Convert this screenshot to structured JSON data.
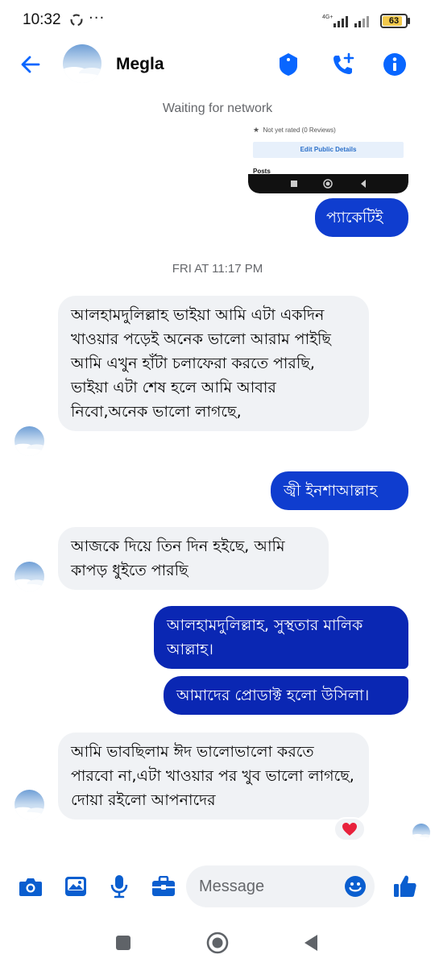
{
  "status_bar": {
    "time": "10:32",
    "dots": "···",
    "battery": "63"
  },
  "header": {
    "contact_name": "Megla"
  },
  "chat": {
    "network_status": "Waiting for network",
    "shared_screenshot": {
      "rating_text": "Not yet rated (0 Reviews)",
      "button_text": "Edit Public Details",
      "posts_text": "Posts"
    },
    "timestamp": "FRI AT 11:17 PM",
    "messages": [
      {
        "from": "me",
        "text": "প্যাকেটিই"
      },
      {
        "from": "them",
        "text": "আলহামদুলিল্লাহ ভাইয়া আমি এটা একদিন খাওয়ার পড়েই অনেক ভালো আরাম পাইছি আমি এখুন হাঁটা চলাফেরা করতে পারছি, ভাইয়া এটা শেষ হলে আমি আবার নিবো,অনেক  ভালো লাগছে,"
      },
      {
        "from": "me",
        "text": "জ্বী ইনশাআল্লাহ"
      },
      {
        "from": "them",
        "text": "আজকে দিয়ে তিন দিন হইছে, আমি কাপড় ধুইতে পারছি"
      },
      {
        "from": "me",
        "text": "আলহামদুলিল্লাহ, সুস্থতার মালিক আল্লাহ।"
      },
      {
        "from": "me",
        "text": "আমাদের প্রোডাক্ট হলো উসিলা।"
      },
      {
        "from": "them",
        "text": "আমি ভাবছিলাম ঈদ ভালোভালো করতে পারবো না,এটা খাওয়ার পর খুব ভালো লাগছে, দোয়া রইলো আপনাদের"
      }
    ],
    "reaction": "heart"
  },
  "composer": {
    "placeholder": "Message"
  },
  "colors": {
    "accent": "#0866ff",
    "outgoing_bubble": "#0f3dcf",
    "incoming_bubble": "#f0f2f5"
  },
  "icons": [
    "back-arrow-icon",
    "shield-icon",
    "video-call-add-icon",
    "info-icon",
    "camera-icon",
    "gallery-icon",
    "microphone-icon",
    "briefcase-icon",
    "emoji-icon",
    "thumbs-up-icon",
    "nav-square-icon",
    "nav-home-icon",
    "nav-back-icon"
  ]
}
